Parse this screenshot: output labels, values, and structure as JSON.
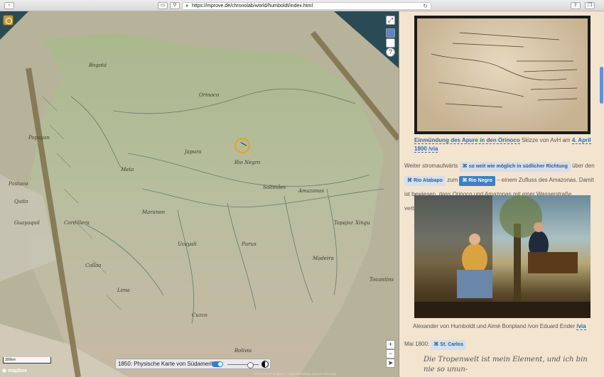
{
  "browser": {
    "url": "https://mprove.de/chronolab/world/humboldt/index.html"
  },
  "map": {
    "scale_label": "300km",
    "logo_text": "mapbox",
    "zoom_in": "+",
    "zoom_out": "−",
    "compass": "➤",
    "fullscreen": "⤢",
    "help": "?",
    "layer_label": "1850: Physische Karte von Südamerika",
    "attribution": "Chronolab © Mapbox © OpenStreetMap Improve this map",
    "labels": [
      "Bogotá",
      "Meta",
      "Orinoco",
      "Rio Negro",
      "Amazonas",
      "Maranon",
      "Ucayali",
      "Purus",
      "Madeira",
      "Solimões",
      "Japura",
      "Lima",
      "Cuzco",
      "Bolivia",
      "Xingu",
      "Tocantins",
      "Tapajoz",
      "Cordillera",
      "Guayaquil",
      "Pastaco",
      "Popayan",
      "Quito",
      "Callao"
    ]
  },
  "article": {
    "cap1_link": "Einmündung des Apure in den Orinoco",
    "cap1_text": " Skizze von AvH am ",
    "cap1_date": "4. April 1800",
    "cap1_via": "/via",
    "p1_a": "Weiter stromaufwärts ",
    "chip_south": "⌘ so weit wie möglich in südlicher Richtung",
    "p1_b": " über den",
    "chip_atabapo": "⌘ Rio Atabapo",
    "p1_c": " zum ",
    "chip_negro": "⌘ Rio Negro",
    "p1_d": " – einem Zufluss des Amazonas. Damit ist bewiesen, dass Orinoco und Amazonas mit einer Wasserstraße verbunden sind.",
    "cap2": "Alexander von Humboldt und Aimé Bonpland /von Eduard Ender ",
    "cap2_via": "/via",
    "date_label": "Mai 1800: ",
    "chip_carlos": "⌘ St. Carlos",
    "quote": "Die Tropenwelt ist mein Element, und ich bin nie so unun-"
  },
  "colors": {
    "accent": "#3b80c7",
    "panel_bg": "#f3e4cf",
    "ring": "#e8a21c"
  }
}
